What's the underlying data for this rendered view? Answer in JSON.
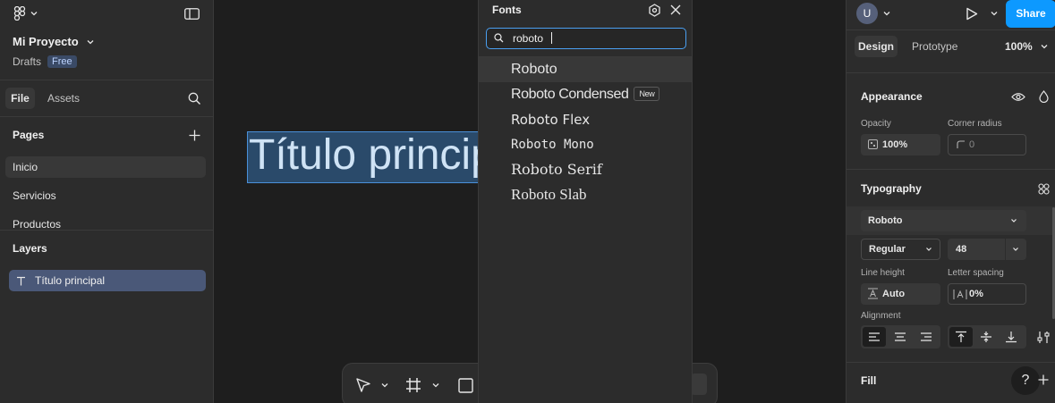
{
  "left": {
    "project_name": "Mi Proyecto",
    "drafts": "Drafts",
    "plan": "Free",
    "tabs": [
      {
        "label": "File"
      },
      {
        "label": "Assets"
      }
    ],
    "pages_title": "Pages",
    "pages": [
      {
        "label": "Inicio"
      },
      {
        "label": "Servicios"
      },
      {
        "label": "Productos"
      }
    ],
    "layers_title": "Layers",
    "layers": [
      {
        "label": "Título principal"
      }
    ]
  },
  "canvas": {
    "text_layer": "Título principal"
  },
  "font_panel": {
    "title": "Fonts",
    "search_value": "roboto",
    "fonts": [
      {
        "label": "Roboto"
      },
      {
        "label": "Roboto Condensed",
        "badge": "New"
      },
      {
        "label": "Roboto Flex"
      },
      {
        "label": "Roboto Mono"
      },
      {
        "label": "Roboto Serif"
      },
      {
        "label": "Roboto Slab"
      }
    ]
  },
  "right": {
    "avatar_initial": "U",
    "share_label": "Share",
    "tabs": [
      {
        "label": "Design"
      },
      {
        "label": "Prototype"
      }
    ],
    "zoom": "100%",
    "appearance": {
      "title": "Appearance",
      "opacity_label": "Opacity",
      "opacity_value": "100%",
      "corner_radius_label": "Corner radius",
      "corner_radius_value": "0"
    },
    "typography": {
      "title": "Typography",
      "font_family": "Roboto",
      "font_style": "Regular",
      "font_size": "48",
      "line_height_label": "Line height",
      "line_height_value": "Auto",
      "letter_spacing_label": "Letter spacing",
      "letter_spacing_value": "0%",
      "alignment_label": "Alignment"
    },
    "fill": {
      "title": "Fill"
    },
    "help": "?"
  },
  "colors": {
    "accent": "#0d99ff",
    "selection": "#4a90d9",
    "panel": "#2c2c2c",
    "canvas": "#1e1e1e"
  }
}
